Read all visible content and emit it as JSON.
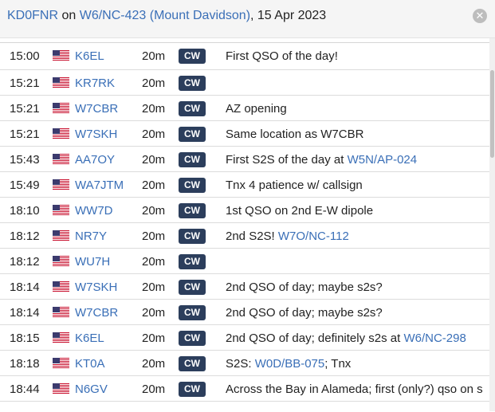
{
  "header": {
    "callsign": "KD0FNR",
    "on_text": "on",
    "summit": "W6/NC-423 (Mount Davidson)",
    "date": ", 15 Apr 2023",
    "close_icon": "close-icon"
  },
  "columns": [
    "time",
    "flag",
    "callsign",
    "band",
    "mode",
    "comment"
  ],
  "rows": [
    {
      "time": "15:00",
      "call": "K6EL",
      "band": "20m",
      "mode": "CW",
      "comment": "First QSO of the day!",
      "ref": ""
    },
    {
      "time": "15:21",
      "call": "KR7RK",
      "band": "20m",
      "mode": "CW",
      "comment": "",
      "ref": ""
    },
    {
      "time": "15:21",
      "call": "W7CBR",
      "band": "20m",
      "mode": "CW",
      "comment": "AZ opening",
      "ref": ""
    },
    {
      "time": "15:21",
      "call": "W7SKH",
      "band": "20m",
      "mode": "CW",
      "comment": "Same location as W7CBR",
      "ref": ""
    },
    {
      "time": "15:43",
      "call": "AA7OY",
      "band": "20m",
      "mode": "CW",
      "comment": "First S2S of the day at ",
      "ref": "W5N/AP-024"
    },
    {
      "time": "15:49",
      "call": "WA7JTM",
      "band": "20m",
      "mode": "CW",
      "comment": "Tnx 4 patience w/ callsign",
      "ref": ""
    },
    {
      "time": "18:10",
      "call": "WW7D",
      "band": "20m",
      "mode": "CW",
      "comment": "1st QSO on 2nd E-W dipole",
      "ref": ""
    },
    {
      "time": "18:12",
      "call": "NR7Y",
      "band": "20m",
      "mode": "CW",
      "comment": "2nd S2S! ",
      "ref": "W7O/NC-112"
    },
    {
      "time": "18:12",
      "call": "WU7H",
      "band": "20m",
      "mode": "CW",
      "comment": "",
      "ref": ""
    },
    {
      "time": "18:14",
      "call": "W7SKH",
      "band": "20m",
      "mode": "CW",
      "comment": "2nd QSO of day; maybe s2s?",
      "ref": ""
    },
    {
      "time": "18:14",
      "call": "W7CBR",
      "band": "20m",
      "mode": "CW",
      "comment": "2nd QSO of day; maybe s2s?",
      "ref": ""
    },
    {
      "time": "18:15",
      "call": "K6EL",
      "band": "20m",
      "mode": "CW",
      "comment": "2nd QSO of day; definitely s2s at ",
      "ref": "W6/NC-298"
    },
    {
      "time": "18:18",
      "call": "KT0A",
      "band": "20m",
      "mode": "CW",
      "comment": "S2S: ",
      "ref": "W0D/BB-075",
      "suffix": "; Tnx"
    },
    {
      "time": "18:44",
      "call": "N6GV",
      "band": "20m",
      "mode": "CW",
      "comment": "Across the Bay in Alameda; first (only?) qso on s",
      "ref": ""
    }
  ],
  "colors": {
    "link": "#3a6fb7",
    "badge": "#2c3e5c",
    "header_bg": "#f5f5f5"
  },
  "icons": {
    "flag": "us-flag-icon",
    "close": "close-icon"
  }
}
